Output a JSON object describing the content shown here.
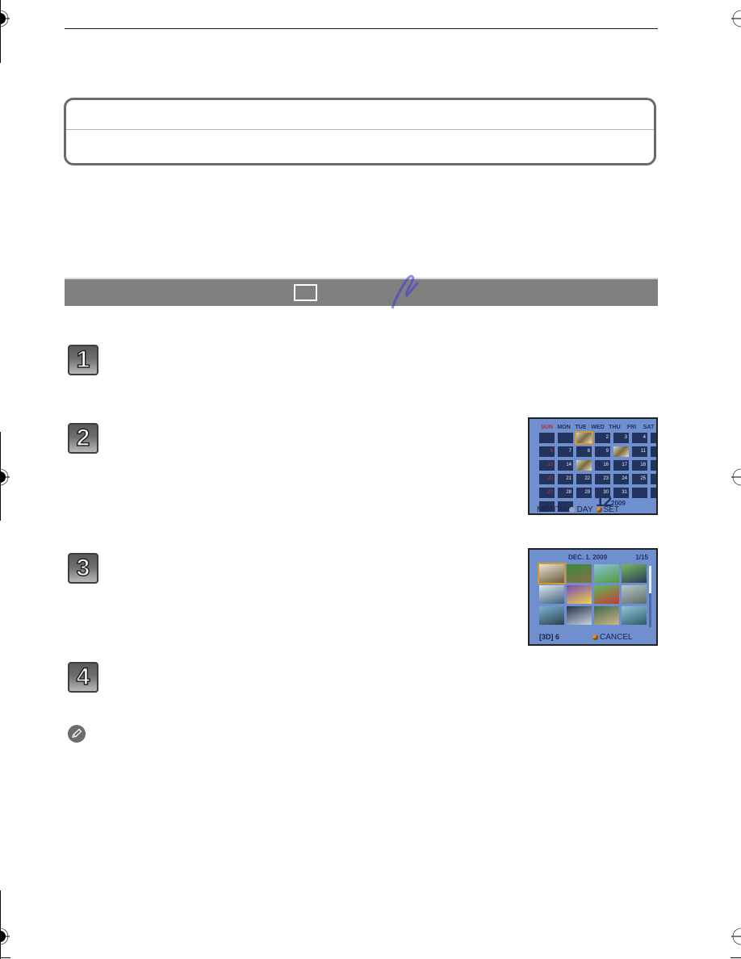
{
  "page": {
    "title_box": {
      "top_text": "",
      "bottom_text": ""
    },
    "section_bar": {
      "label": "",
      "mode_icon": "playback-mode-box"
    },
    "steps": [
      {
        "number": "1",
        "text": ""
      },
      {
        "number": "2",
        "text": ""
      },
      {
        "number": "3",
        "text": ""
      },
      {
        "number": "4",
        "text": ""
      }
    ],
    "note": {
      "icon": "pencil-note-icon",
      "text": ""
    }
  },
  "calendar_screen": {
    "weekdays": [
      "SUN",
      "MON",
      "TUE",
      "WED",
      "THU",
      "FRI",
      "SAT"
    ],
    "cells": [
      "",
      "",
      "1",
      "2",
      "3",
      "4",
      "5",
      "6",
      "7",
      "8",
      "9",
      "10",
      "11",
      "12",
      "13",
      "14",
      "15",
      "16",
      "17",
      "18",
      "19",
      "20",
      "21",
      "22",
      "23",
      "24",
      "25",
      "26",
      "27",
      "28",
      "29",
      "30",
      "31",
      "",
      "",
      "",
      ""
    ],
    "photo_days": [
      "1",
      "10",
      "15"
    ],
    "selected_day": "1",
    "month": "12",
    "year": "2009",
    "footer": {
      "month_label": "MONTH",
      "day_label": "DAY",
      "set_label": "SET"
    },
    "colors": {
      "screen_bg": "#6f8fcf",
      "cell_bg": "#22345e",
      "sunday": "#c0282a",
      "selection": "#d39a2a"
    }
  },
  "thumbnail_screen": {
    "date": "DEC. 1. 2009",
    "page_counter": "1/15",
    "thumbnails": [
      {
        "scene": "bride-portrait",
        "colors": [
          "#e9e3d6",
          "#6b5a3a"
        ]
      },
      {
        "scene": "person-on-lawn",
        "colors": [
          "#3c8a3a",
          "#8a6d4a"
        ]
      },
      {
        "scene": "garden-field",
        "colors": [
          "#8ac3d9",
          "#4f9a3c"
        ]
      },
      {
        "scene": "person-outdoors",
        "colors": [
          "#78b85a",
          "#2a3a5a"
        ]
      },
      {
        "scene": "child-laughing",
        "colors": [
          "#dfe8ee",
          "#3d5f7d"
        ]
      },
      {
        "scene": "purple-flower",
        "colors": [
          "#7b4bb3",
          "#f2d24a"
        ]
      },
      {
        "scene": "child-red-shirt",
        "colors": [
          "#5dbb5a",
          "#c63a32"
        ]
      },
      {
        "scene": "beach-shore",
        "colors": [
          "#b7c7c9",
          "#5d6b68"
        ]
      },
      {
        "scene": "couple-beach",
        "colors": [
          "#79b6d3",
          "#2f3f4f"
        ]
      },
      {
        "scene": "group-photo",
        "colors": [
          "#2a3448",
          "#c7d2e2"
        ]
      },
      {
        "scene": "family-closeup",
        "colors": [
          "#3f6a4a",
          "#d0b48a"
        ]
      },
      {
        "scene": "seaside-walk",
        "colors": [
          "#8fc6d6",
          "#2e5a6a"
        ]
      }
    ],
    "selected_index": 0,
    "footer_left": "[3D] 6",
    "cancel_label": "CANCEL"
  }
}
